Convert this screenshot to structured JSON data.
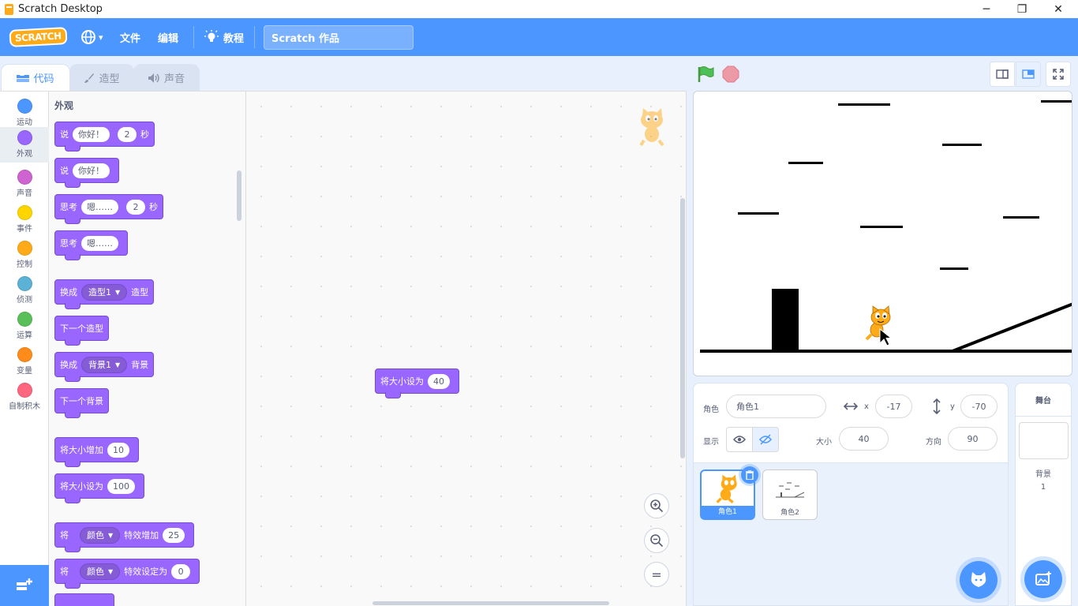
{
  "window": {
    "title": "Scratch Desktop",
    "minimize": "─",
    "restore": "❐",
    "close": "✕"
  },
  "menubar": {
    "logo": "SCRATCH",
    "language_arrow": "▾",
    "file": "文件",
    "edit": "编辑",
    "tutorials": "教程",
    "project_title": "Scratch 作品"
  },
  "tabs": {
    "code": "代码",
    "costumes": "造型",
    "sounds": "声音"
  },
  "categories": [
    {
      "label": "运动",
      "color": "#4c97ff"
    },
    {
      "label": "外观",
      "color": "#9966ff"
    },
    {
      "label": "声音",
      "color": "#cf63cf"
    },
    {
      "label": "事件",
      "color": "#ffd500"
    },
    {
      "label": "控制",
      "color": "#ffab19"
    },
    {
      "label": "侦测",
      "color": "#5cb1d6"
    },
    {
      "label": "运算",
      "color": "#59c059"
    },
    {
      "label": "变量",
      "color": "#ff8c1a"
    },
    {
      "label": "自制积木",
      "color": "#ff6680"
    }
  ],
  "palette": {
    "section_title": "外观",
    "say_for": {
      "say": "说",
      "msg": "你好！",
      "secs": "2",
      "unit": "秒"
    },
    "say": {
      "say": "说",
      "msg": "你好！"
    },
    "think_for": {
      "think": "思考",
      "msg": "嗯……",
      "secs": "2",
      "unit": "秒"
    },
    "think": {
      "think": "思考",
      "msg": "嗯……"
    },
    "switch_costume": {
      "pre": "换成",
      "value": "造型1",
      "post": "造型"
    },
    "next_costume": "下一个造型",
    "switch_backdrop": {
      "pre": "换成",
      "value": "背景1",
      "post": "背景"
    },
    "next_backdrop": "下一个背景",
    "change_size": {
      "label": "将大小增加",
      "value": "10"
    },
    "set_size": {
      "label": "将大小设为",
      "value": "100"
    },
    "change_effect": {
      "pre": "将",
      "effect": "颜色",
      "mid": "特效增加",
      "value": "25"
    },
    "set_effect": {
      "pre": "将",
      "effect": "颜色",
      "mid": "特效设定为",
      "value": "0"
    }
  },
  "workspace": {
    "block": {
      "label": "将大小设为",
      "value": "40"
    },
    "zoom_in": "+",
    "zoom_out": "−",
    "zoom_reset": "="
  },
  "sprite_info": {
    "sprite_label": "角色",
    "sprite_name": "角色1",
    "x_label": "x",
    "x": "-17",
    "y_label": "y",
    "y": "-70",
    "show_label": "显示",
    "size_label": "大小",
    "size": "40",
    "direction_label": "方向",
    "direction": "90"
  },
  "sprites": [
    {
      "name": "角色1"
    },
    {
      "name": "角色2"
    }
  ],
  "stage_pane": {
    "title": "舞台",
    "backdrops_label": "背景",
    "backdrops_count": "1"
  }
}
